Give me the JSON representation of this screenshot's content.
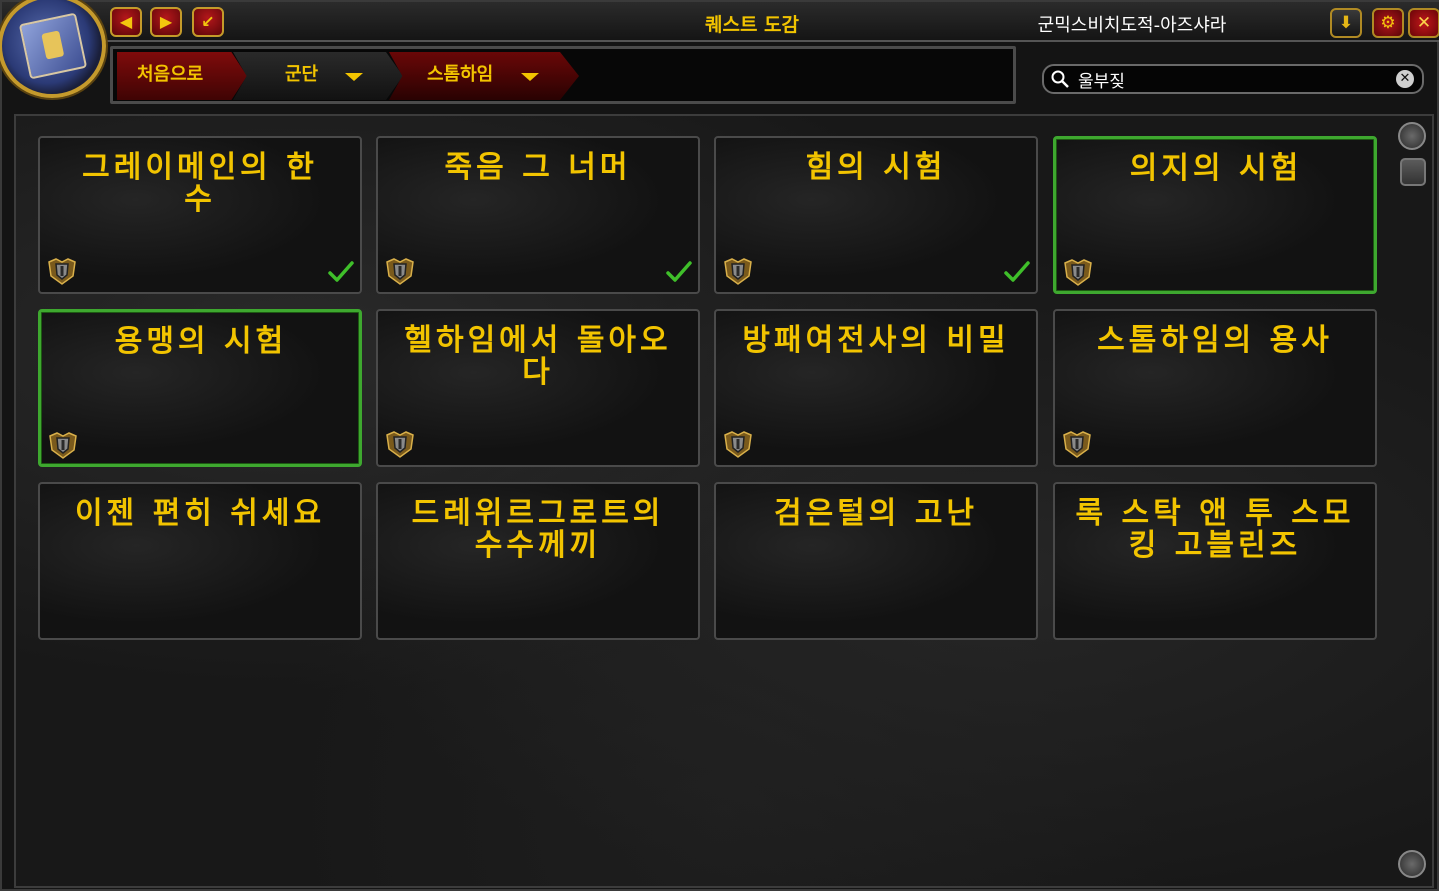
{
  "window": {
    "title": "퀘스트 도감",
    "realm": "군믹스비치도적-아즈샤라"
  },
  "titlebar": {
    "back_icon": "◀",
    "forward_icon": "▶",
    "return_icon": "↙",
    "download_icon": "⬇",
    "settings_icon": "⚙",
    "close_icon": "✕"
  },
  "breadcrumb": {
    "home": "처음으로",
    "guild": "군단",
    "zone": "스톰하임"
  },
  "search": {
    "value": "울부짖",
    "clear_icon": "✕"
  },
  "cards": [
    {
      "title": "그레이메인의 한 수",
      "completed": true,
      "selected": false,
      "has_shield": true
    },
    {
      "title": "죽음 그 너머",
      "completed": true,
      "selected": false,
      "has_shield": true
    },
    {
      "title": "힘의 시험",
      "completed": true,
      "selected": false,
      "has_shield": true
    },
    {
      "title": "의지의 시험",
      "completed": false,
      "selected": true,
      "has_shield": true
    },
    {
      "title": "용맹의 시험",
      "completed": false,
      "selected": true,
      "has_shield": true
    },
    {
      "title": "헬하임에서 돌아오다",
      "completed": false,
      "selected": false,
      "has_shield": true
    },
    {
      "title": "방패여전사의 비밀",
      "completed": false,
      "selected": false,
      "has_shield": true
    },
    {
      "title": "스톰하임의 용사",
      "completed": false,
      "selected": false,
      "has_shield": true
    },
    {
      "title": "이젠 편히 쉬세요",
      "completed": false,
      "selected": false,
      "has_shield": false
    },
    {
      "title": "드레위르그로트의 수수께끼",
      "completed": false,
      "selected": false,
      "has_shield": false
    },
    {
      "title": "검은털의 고난",
      "completed": false,
      "selected": false,
      "has_shield": false
    },
    {
      "title": "록 스탁 앤 투 스모킹 고블린즈",
      "completed": false,
      "selected": false,
      "has_shield": false
    }
  ],
  "colors": {
    "title_gold": "#f2c400",
    "selected_border": "#3ea82f",
    "check_green": "#3fbf2a"
  }
}
